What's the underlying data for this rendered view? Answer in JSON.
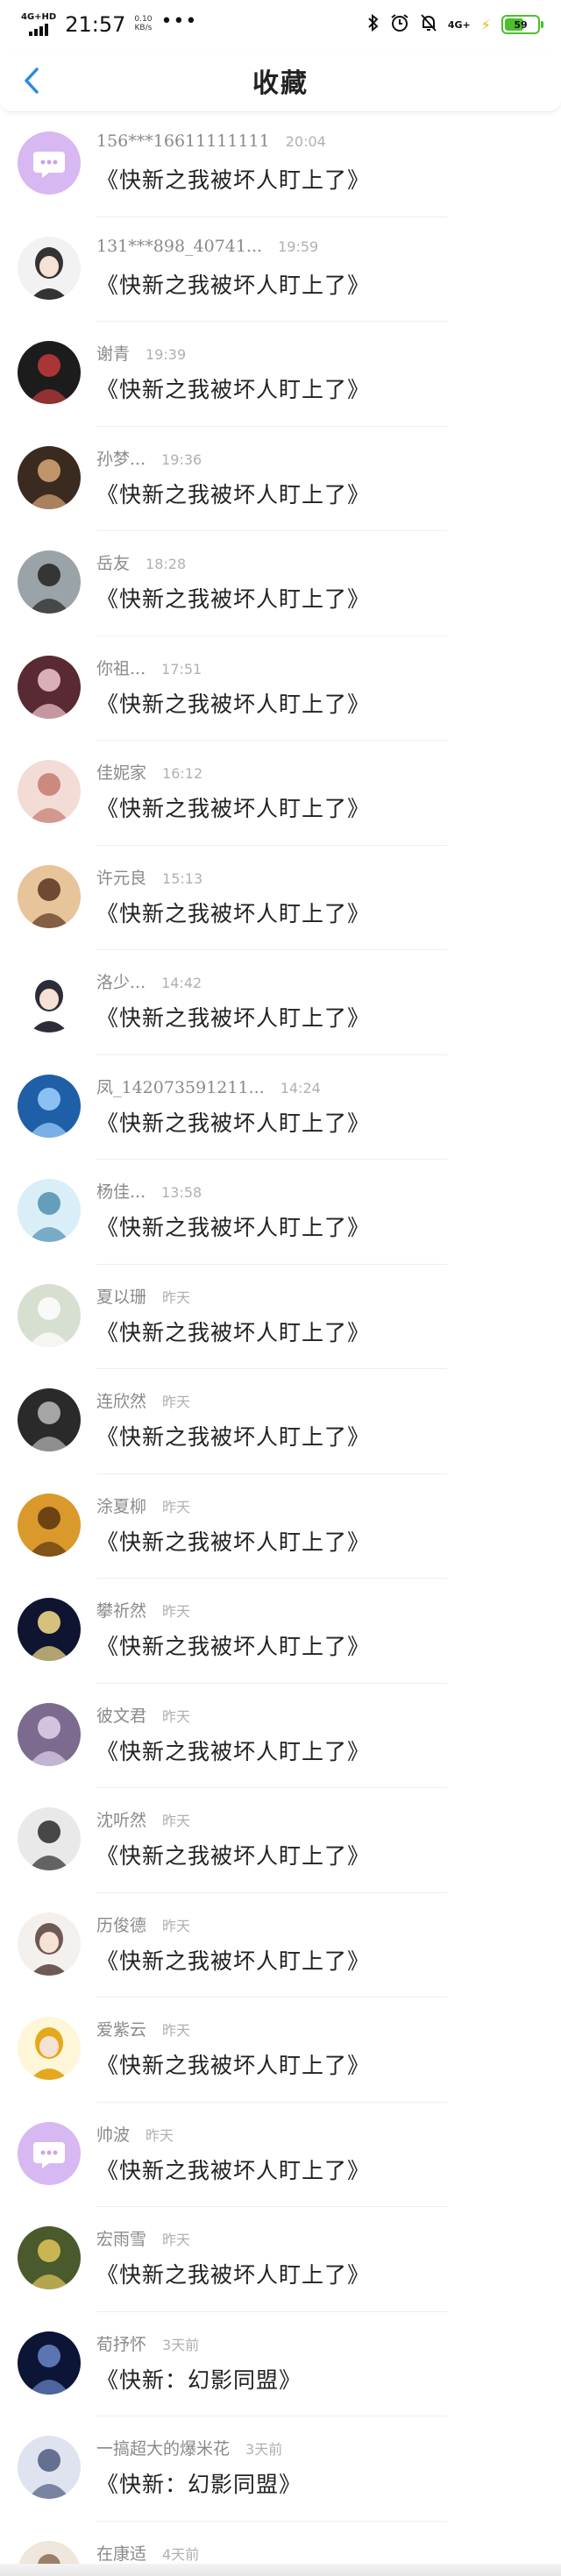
{
  "status_bar": {
    "network": "4G+HD",
    "time": "21:57",
    "speed_value": "0.10",
    "speed_unit": "KB/s",
    "more_dots": "•••",
    "right_network": "4G+",
    "battery": "59",
    "battery_fraction": 0.59,
    "icons": [
      "bluetooth-icon",
      "alarm-icon",
      "mute-bell-icon",
      "signal-icon",
      "battery-icon",
      "charging-icon"
    ]
  },
  "header": {
    "title": "收藏",
    "back_icon": "chevron-left-icon",
    "accent_color": "#2a8be0"
  },
  "favorites": [
    {
      "user": "156***16611111111",
      "time": "20:04",
      "work": "《快新之我被坏人盯上了》",
      "avatar": {
        "bg": "#d7b8f2",
        "fg": "#ffffff",
        "type": "default"
      }
    },
    {
      "user": "131***898_40741...",
      "time": "19:59",
      "work": "《快新之我被坏人盯上了》",
      "avatar": {
        "bg": "#f2f2f2",
        "fg": "#333333",
        "type": "anime"
      }
    },
    {
      "user": "谢青",
      "time": "19:39",
      "work": "《快新之我被坏人盯上了》",
      "avatar": {
        "bg": "#1c1c1c",
        "fg": "#c33a3a",
        "type": "photo"
      }
    },
    {
      "user": "孙梦...",
      "time": "19:36",
      "work": "《快新之我被坏人盯上了》",
      "avatar": {
        "bg": "#3b2a20",
        "fg": "#d9a878",
        "type": "photo"
      }
    },
    {
      "user": "岳友",
      "time": "18:28",
      "work": "《快新之我被坏人盯上了》",
      "avatar": {
        "bg": "#9aa3a8",
        "fg": "#222222",
        "type": "photo"
      }
    },
    {
      "user": "你祖...",
      "time": "17:51",
      "work": "《快新之我被坏人盯上了》",
      "avatar": {
        "bg": "#5a2a34",
        "fg": "#f2c7cf",
        "type": "photo"
      }
    },
    {
      "user": "佳妮家",
      "time": "16:12",
      "work": "《快新之我被坏人盯上了》",
      "avatar": {
        "bg": "#f3dcd6",
        "fg": "#c47a6d",
        "type": "photo"
      }
    },
    {
      "user": "许元良",
      "time": "15:13",
      "work": "《快新之我被坏人盯上了》",
      "avatar": {
        "bg": "#e7c49a",
        "fg": "#5a3420",
        "type": "photo"
      }
    },
    {
      "user": "洛少...",
      "time": "14:42",
      "work": "《快新之我被坏人盯上了》",
      "avatar": {
        "bg": "#ffffff",
        "fg": "#2d2d3a",
        "type": "anime"
      }
    },
    {
      "user": "凤_142073591211...",
      "time": "14:24",
      "work": "《快新之我被坏人盯上了》",
      "avatar": {
        "bg": "#1f5fa8",
        "fg": "#9fd2ff",
        "type": "photo"
      }
    },
    {
      "user": "杨佳...",
      "time": "13:58",
      "work": "《快新之我被坏人盯上了》",
      "avatar": {
        "bg": "#d9eef7",
        "fg": "#4f8fb0",
        "type": "photo"
      }
    },
    {
      "user": "夏以珊",
      "time": "昨天",
      "work": "《快新之我被坏人盯上了》",
      "avatar": {
        "bg": "#d6dfd0",
        "fg": "#ffffff",
        "type": "photo"
      }
    },
    {
      "user": "连欣然",
      "time": "昨天",
      "work": "《快新之我被坏人盯上了》",
      "avatar": {
        "bg": "#2a2a2a",
        "fg": "#bbbbbb",
        "type": "photo"
      }
    },
    {
      "user": "涂夏柳",
      "time": "昨天",
      "work": "《快新之我被坏人盯上了》",
      "avatar": {
        "bg": "#d99a2b",
        "fg": "#5a3410",
        "type": "photo"
      }
    },
    {
      "user": "攀祈然",
      "time": "昨天",
      "work": "《快新之我被坏人盯上了》",
      "avatar": {
        "bg": "#0f1430",
        "fg": "#f7e08a",
        "type": "photo"
      }
    },
    {
      "user": "彼文君",
      "time": "昨天",
      "work": "《快新之我被坏人盯上了》",
      "avatar": {
        "bg": "#7c6a8f",
        "fg": "#e2d4ef",
        "type": "photo"
      }
    },
    {
      "user": "沈听然",
      "time": "昨天",
      "work": "《快新之我被坏人盯上了》",
      "avatar": {
        "bg": "#e9e9e9",
        "fg": "#2a2a2a",
        "type": "photo"
      }
    },
    {
      "user": "历俊德",
      "time": "昨天",
      "work": "《快新之我被坏人盯上了》",
      "avatar": {
        "bg": "#f4f0ee",
        "fg": "#6e5a55",
        "type": "anime"
      }
    },
    {
      "user": "爱紫云",
      "time": "昨天",
      "work": "《快新之我被坏人盯上了》",
      "avatar": {
        "bg": "#fdf6d8",
        "fg": "#e3a81c",
        "type": "anime"
      }
    },
    {
      "user": "帅波",
      "time": "昨天",
      "work": "《快新之我被坏人盯上了》",
      "avatar": {
        "bg": "#d7b8f2",
        "fg": "#ffffff",
        "type": "default"
      }
    },
    {
      "user": "宏雨雪",
      "time": "昨天",
      "work": "《快新之我被坏人盯上了》",
      "avatar": {
        "bg": "#4a5a2c",
        "fg": "#e0c65a",
        "type": "photo"
      }
    },
    {
      "user": "荀抒怀",
      "time": "3天前",
      "work": "《快新：幻影同盟》",
      "avatar": {
        "bg": "#0c1536",
        "fg": "#6a86c9",
        "type": "photo"
      }
    },
    {
      "user": "一搞超大的爆米花",
      "time": "3天前",
      "work": "《快新：幻影同盟》",
      "avatar": {
        "bg": "#dfe3ef",
        "fg": "#4f5a80",
        "type": "photo"
      }
    },
    {
      "user": "在康适",
      "time": "4天前",
      "work": "",
      "avatar": {
        "bg": "#efe6dc",
        "fg": "#8b6d57",
        "type": "photo"
      }
    }
  ]
}
